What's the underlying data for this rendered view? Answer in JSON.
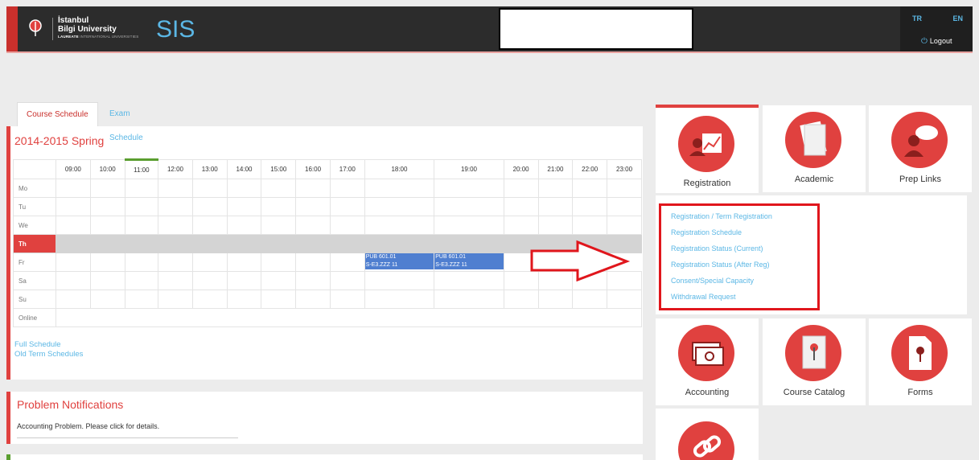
{
  "header": {
    "uni_line1": "İstanbul",
    "uni_line2": "Bilgi University",
    "uni_line3_bold": "LAUREATE",
    "uni_line3": " INTERNATIONAL UNIVERSITIES",
    "app_name": "SIS",
    "lang_tr": "TR",
    "lang_en": "EN",
    "logout": "Logout"
  },
  "tabs": {
    "course": "Course Schedule",
    "exam": "Exam Schedule"
  },
  "schedule": {
    "term": "2014-2015 Spring",
    "hours": [
      "09:00",
      "10:00",
      "11:00",
      "12:00",
      "13:00",
      "14:00",
      "15:00",
      "16:00",
      "17:00",
      "18:00",
      "19:00",
      "20:00",
      "21:00",
      "22:00",
      "23:00"
    ],
    "days": [
      "Mo",
      "Tu",
      "We",
      "Th",
      "Fr",
      "Sa",
      "Su",
      "Online"
    ],
    "class1_line1": "PUB 601.01",
    "class1_line2": "S-E3.ZZZ 11",
    "class2_line1": "PUB 601.01",
    "class2_line2": "S-E3.ZZZ 11"
  },
  "links": {
    "full": "Full Schedule",
    "old": "Old Term Schedules"
  },
  "notifications": {
    "title": "Problem Notifications",
    "message": "Accounting Problem. Please click for details."
  },
  "tiles": {
    "registration": "Registration",
    "academic": "Academic",
    "prep": "Prep Links",
    "accounting": "Accounting",
    "catalog": "Course Catalog",
    "forms": "Forms"
  },
  "reg_menu": [
    "Registration / Term Registration",
    "Registration Schedule",
    "Registration Status (Current)",
    "Registration Status (After Reg)",
    "Consent/Special Capacity",
    "Withdrawal Request"
  ],
  "colors": {
    "accent": "#e0413f",
    "link": "#5bb7e5",
    "header_bg": "#2c2c2c",
    "class_block": "#4f7fd0"
  }
}
